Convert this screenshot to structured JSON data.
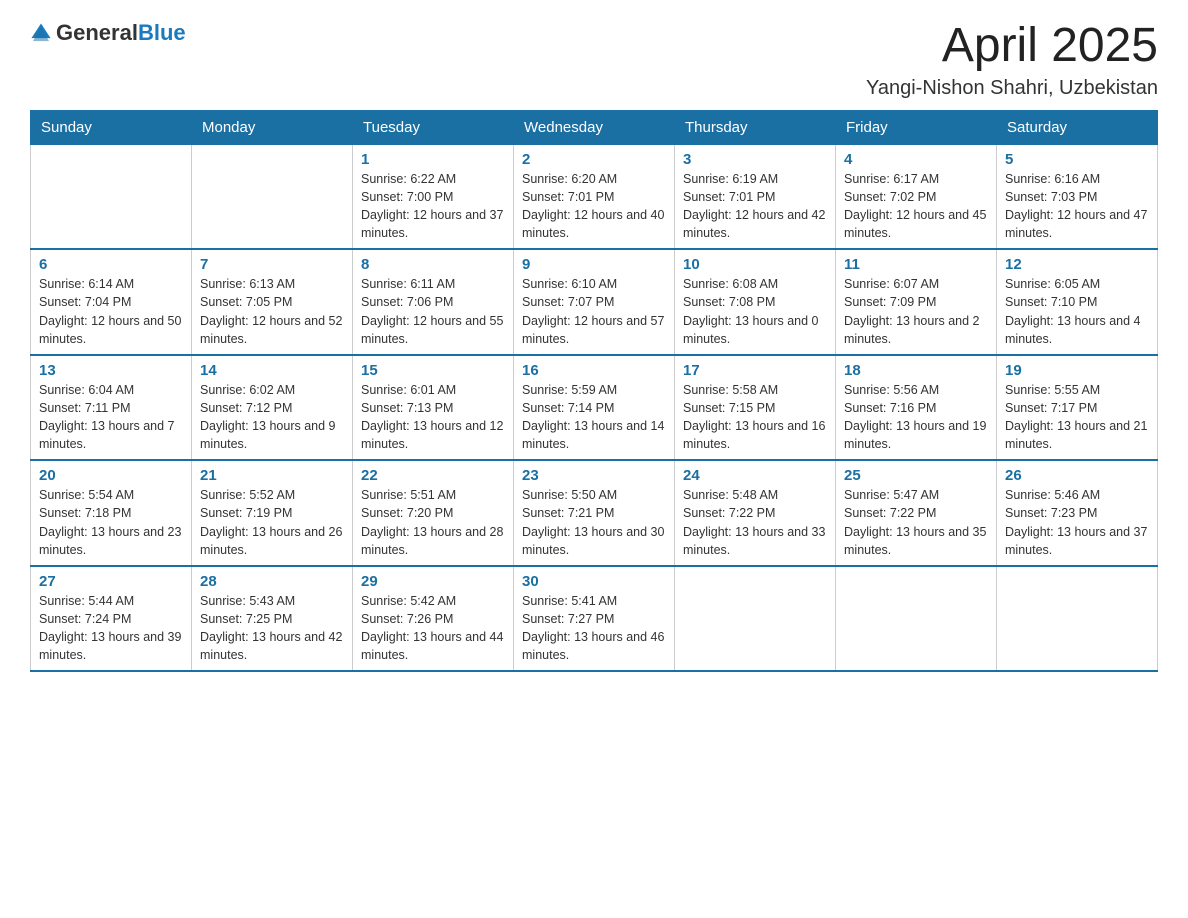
{
  "logo": {
    "general": "General",
    "blue": "Blue"
  },
  "title": "April 2025",
  "subtitle": "Yangi-Nishon Shahri, Uzbekistan",
  "weekdays": [
    "Sunday",
    "Monday",
    "Tuesday",
    "Wednesday",
    "Thursday",
    "Friday",
    "Saturday"
  ],
  "weeks": [
    [
      {
        "empty": true
      },
      {
        "empty": true
      },
      {
        "day": "1",
        "sunrise": "6:22 AM",
        "sunset": "7:00 PM",
        "daylight": "12 hours and 37 minutes."
      },
      {
        "day": "2",
        "sunrise": "6:20 AM",
        "sunset": "7:01 PM",
        "daylight": "12 hours and 40 minutes."
      },
      {
        "day": "3",
        "sunrise": "6:19 AM",
        "sunset": "7:01 PM",
        "daylight": "12 hours and 42 minutes."
      },
      {
        "day": "4",
        "sunrise": "6:17 AM",
        "sunset": "7:02 PM",
        "daylight": "12 hours and 45 minutes."
      },
      {
        "day": "5",
        "sunrise": "6:16 AM",
        "sunset": "7:03 PM",
        "daylight": "12 hours and 47 minutes."
      }
    ],
    [
      {
        "day": "6",
        "sunrise": "6:14 AM",
        "sunset": "7:04 PM",
        "daylight": "12 hours and 50 minutes."
      },
      {
        "day": "7",
        "sunrise": "6:13 AM",
        "sunset": "7:05 PM",
        "daylight": "12 hours and 52 minutes."
      },
      {
        "day": "8",
        "sunrise": "6:11 AM",
        "sunset": "7:06 PM",
        "daylight": "12 hours and 55 minutes."
      },
      {
        "day": "9",
        "sunrise": "6:10 AM",
        "sunset": "7:07 PM",
        "daylight": "12 hours and 57 minutes."
      },
      {
        "day": "10",
        "sunrise": "6:08 AM",
        "sunset": "7:08 PM",
        "daylight": "13 hours and 0 minutes."
      },
      {
        "day": "11",
        "sunrise": "6:07 AM",
        "sunset": "7:09 PM",
        "daylight": "13 hours and 2 minutes."
      },
      {
        "day": "12",
        "sunrise": "6:05 AM",
        "sunset": "7:10 PM",
        "daylight": "13 hours and 4 minutes."
      }
    ],
    [
      {
        "day": "13",
        "sunrise": "6:04 AM",
        "sunset": "7:11 PM",
        "daylight": "13 hours and 7 minutes."
      },
      {
        "day": "14",
        "sunrise": "6:02 AM",
        "sunset": "7:12 PM",
        "daylight": "13 hours and 9 minutes."
      },
      {
        "day": "15",
        "sunrise": "6:01 AM",
        "sunset": "7:13 PM",
        "daylight": "13 hours and 12 minutes."
      },
      {
        "day": "16",
        "sunrise": "5:59 AM",
        "sunset": "7:14 PM",
        "daylight": "13 hours and 14 minutes."
      },
      {
        "day": "17",
        "sunrise": "5:58 AM",
        "sunset": "7:15 PM",
        "daylight": "13 hours and 16 minutes."
      },
      {
        "day": "18",
        "sunrise": "5:56 AM",
        "sunset": "7:16 PM",
        "daylight": "13 hours and 19 minutes."
      },
      {
        "day": "19",
        "sunrise": "5:55 AM",
        "sunset": "7:17 PM",
        "daylight": "13 hours and 21 minutes."
      }
    ],
    [
      {
        "day": "20",
        "sunrise": "5:54 AM",
        "sunset": "7:18 PM",
        "daylight": "13 hours and 23 minutes."
      },
      {
        "day": "21",
        "sunrise": "5:52 AM",
        "sunset": "7:19 PM",
        "daylight": "13 hours and 26 minutes."
      },
      {
        "day": "22",
        "sunrise": "5:51 AM",
        "sunset": "7:20 PM",
        "daylight": "13 hours and 28 minutes."
      },
      {
        "day": "23",
        "sunrise": "5:50 AM",
        "sunset": "7:21 PM",
        "daylight": "13 hours and 30 minutes."
      },
      {
        "day": "24",
        "sunrise": "5:48 AM",
        "sunset": "7:22 PM",
        "daylight": "13 hours and 33 minutes."
      },
      {
        "day": "25",
        "sunrise": "5:47 AM",
        "sunset": "7:22 PM",
        "daylight": "13 hours and 35 minutes."
      },
      {
        "day": "26",
        "sunrise": "5:46 AM",
        "sunset": "7:23 PM",
        "daylight": "13 hours and 37 minutes."
      }
    ],
    [
      {
        "day": "27",
        "sunrise": "5:44 AM",
        "sunset": "7:24 PM",
        "daylight": "13 hours and 39 minutes."
      },
      {
        "day": "28",
        "sunrise": "5:43 AM",
        "sunset": "7:25 PM",
        "daylight": "13 hours and 42 minutes."
      },
      {
        "day": "29",
        "sunrise": "5:42 AM",
        "sunset": "7:26 PM",
        "daylight": "13 hours and 44 minutes."
      },
      {
        "day": "30",
        "sunrise": "5:41 AM",
        "sunset": "7:27 PM",
        "daylight": "13 hours and 46 minutes."
      },
      {
        "empty": true
      },
      {
        "empty": true
      },
      {
        "empty": true
      }
    ]
  ],
  "labels": {
    "sunrise_prefix": "Sunrise: ",
    "sunset_prefix": "Sunset: ",
    "daylight_prefix": "Daylight: "
  }
}
